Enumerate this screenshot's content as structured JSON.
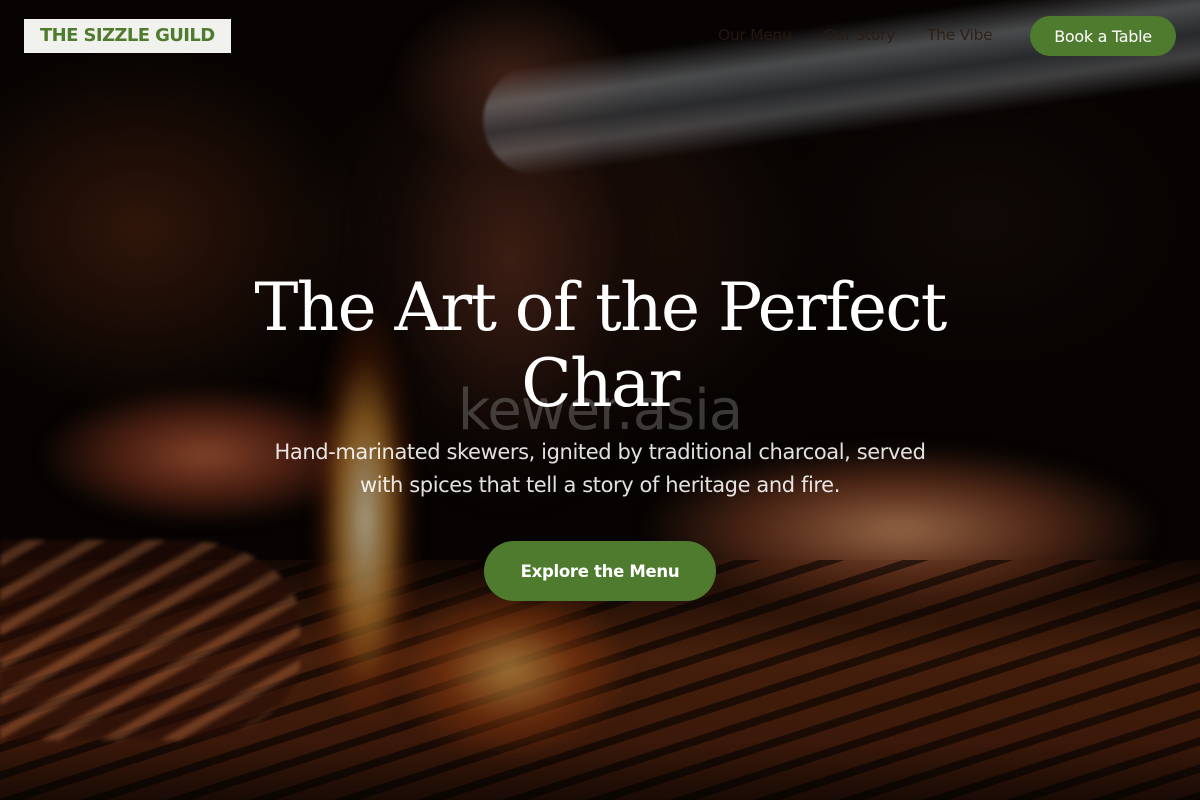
{
  "header": {
    "logo": "THE SIZZLE GUILD",
    "nav": [
      {
        "label": "Our Menu"
      },
      {
        "label": "Our Story"
      },
      {
        "label": "The Vibe"
      }
    ],
    "cta_label": "Book a Table"
  },
  "hero": {
    "title": "The Art of the Perfect Char",
    "subtitle": "Hand-marinated skewers, ignited by traditional charcoal, served with spices that tell a story of heritage and fire.",
    "cta_label": "Explore the Menu",
    "watermark": "kewer.asia"
  },
  "colors": {
    "accent": "#4f7b2e",
    "logo_background": "#f1f1ee",
    "text_light": "#ffffff"
  }
}
